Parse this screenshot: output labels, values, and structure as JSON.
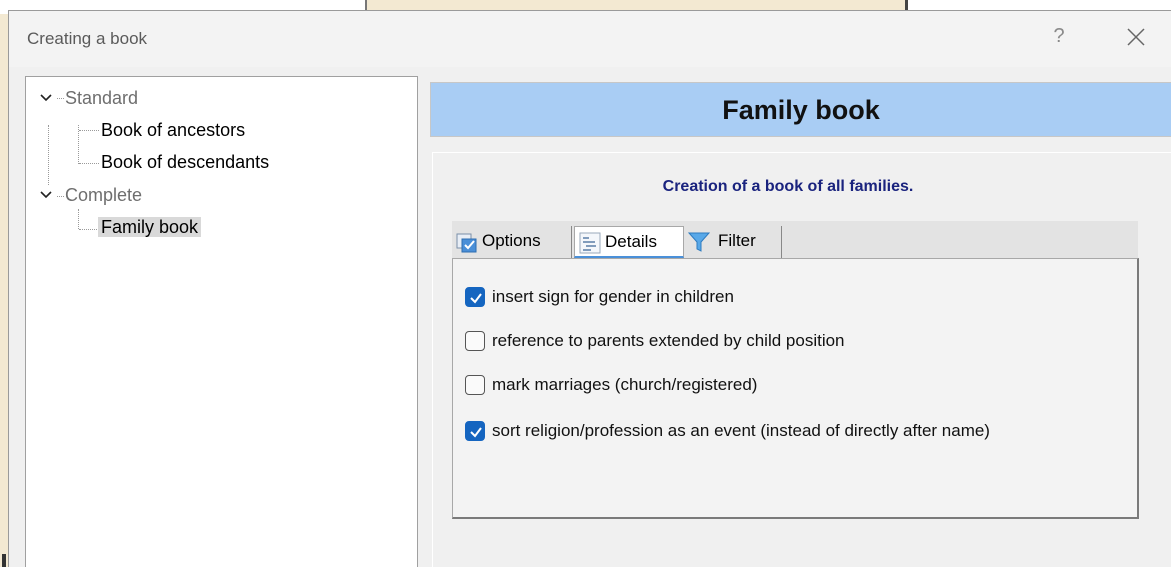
{
  "window": {
    "title": "Creating a book",
    "help_label": "?"
  },
  "tree": {
    "groups": [
      {
        "label": "Standard",
        "children": [
          "Book of ancestors",
          "Book of descendants"
        ]
      },
      {
        "label": "Complete",
        "children": [
          "Family book"
        ]
      }
    ],
    "selected": "Family book"
  },
  "header": {
    "title": "Family book"
  },
  "content": {
    "description": "Creation of a book of all families.",
    "tabs": [
      {
        "label": "Options",
        "icon": "options-checkbox-icon",
        "active": false
      },
      {
        "label": "Details",
        "icon": "details-list-icon",
        "active": true
      },
      {
        "label": "Filter",
        "icon": "filter-funnel-icon",
        "active": false
      }
    ],
    "options": [
      {
        "label": "insert sign for gender in children",
        "checked": true
      },
      {
        "label": "reference to parents extended by child position",
        "checked": false
      },
      {
        "label": "mark marriages (church/registered)",
        "checked": false
      },
      {
        "label": "sort religion/profession as an event (instead of directly after name)",
        "checked": true
      }
    ]
  },
  "colors": {
    "header_bg": "#a9cdf4",
    "description_text": "#1a237e",
    "checkbox_checked": "#1565c0",
    "tab_active_underline": "#4a90d9"
  }
}
